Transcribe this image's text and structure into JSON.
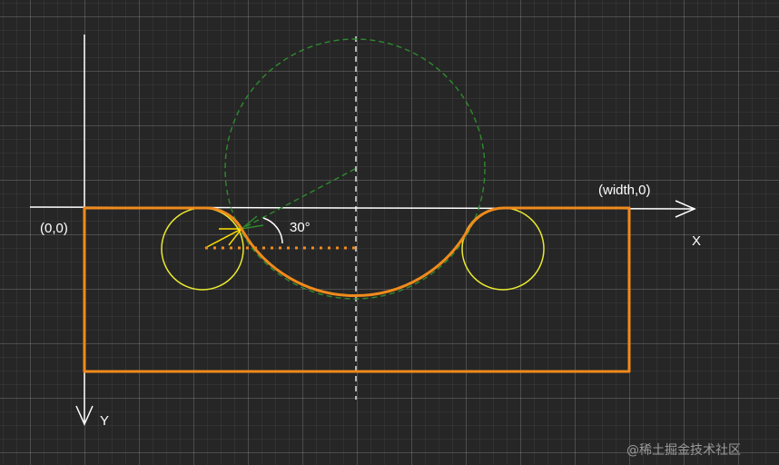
{
  "labels": {
    "origin": "(0,0)",
    "width_point": "(width,0)",
    "x_axis": "X",
    "y_axis": "Y",
    "angle": "30°"
  },
  "watermark": "@稀土掘金技术社区",
  "colors": {
    "background": "#262626",
    "axis": "#ffffff",
    "shape_outline": "#f08a1c",
    "small_circles": "#e8e830",
    "large_circle": "#2e8b2e",
    "radius_line": "#ffe000"
  }
}
